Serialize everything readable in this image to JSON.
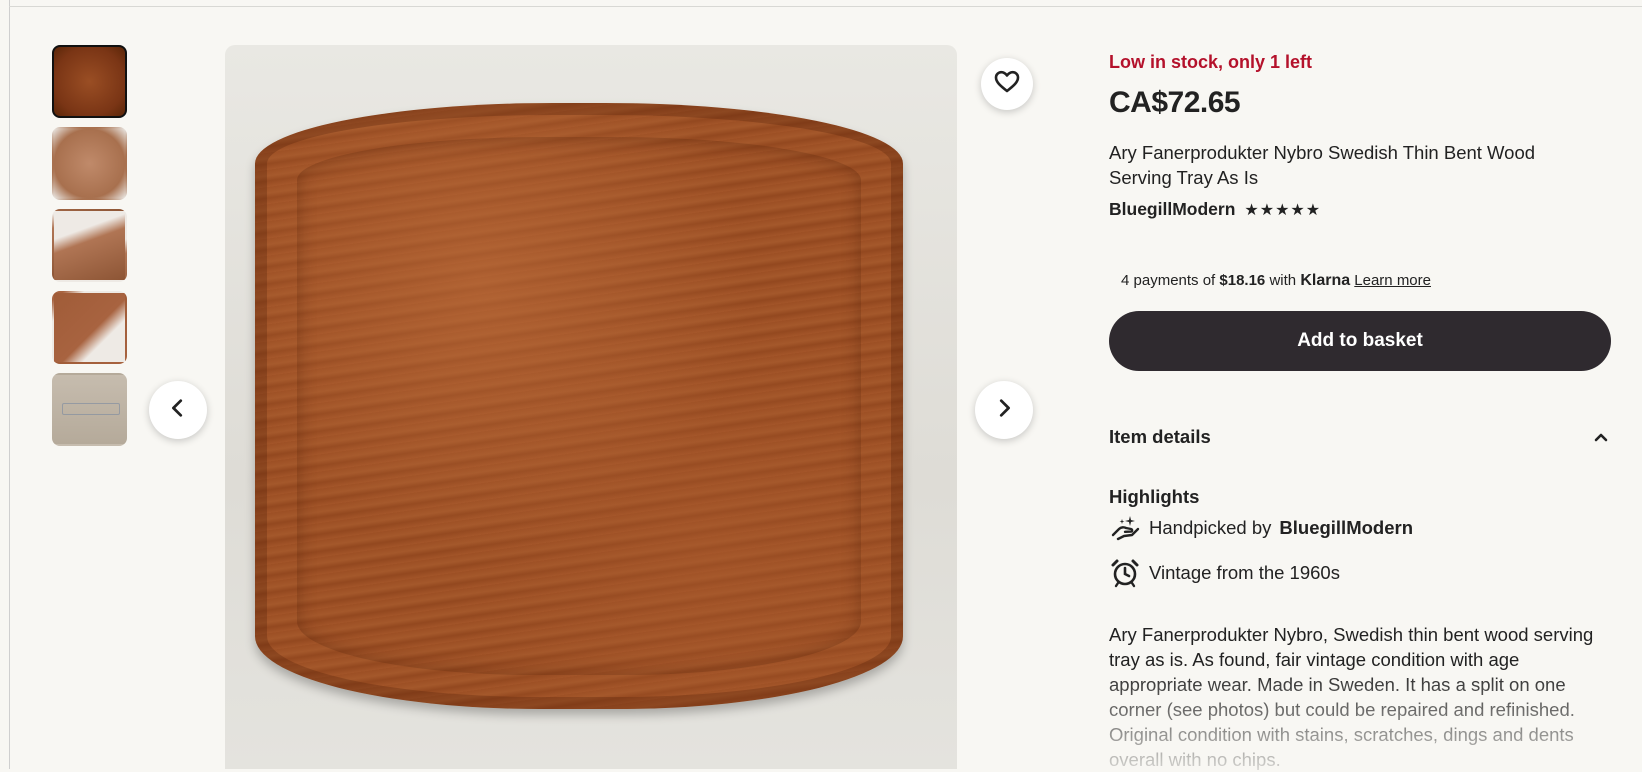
{
  "listing": {
    "stock_notice": "Low in stock, only 1 left",
    "price": "CA$72.65",
    "title": "Ary Fanerprodukter Nybro Swedish Thin Bent Wood Serving Tray As Is",
    "seller": "BluegillModern",
    "rating_stars": "★★★★★",
    "rating": 5
  },
  "payments": {
    "prefix": "4 payments of",
    "amount": "$18.16",
    "with": "with",
    "provider": "Klarna",
    "learn_more": "Learn more"
  },
  "actions": {
    "add_to_basket": "Add to basket"
  },
  "details": {
    "header": "Item details",
    "highlights_label": "Highlights",
    "handpicked_prefix": "Handpicked by",
    "handpicked_by": "BluegillModern",
    "vintage": "Vintage from the 1960s",
    "description": "Ary Fanerprodukter Nybro, Swedish thin bent wood serving tray as is. As found, fair vintage condition with age appropriate wear. Made in Sweden. It has a split on one corner (see photos) but could be repaired and refinished. Original condition with stains, scratches, dings and dents overall with no chips."
  },
  "gallery": {
    "thumbnail_count": 5,
    "active_index": 0
  },
  "colors": {
    "stock_alert": "#b4112b",
    "button_dark": "#2f2a2f",
    "page_bg": "#f8f7f3"
  },
  "icons": {
    "favorite": "heart-icon",
    "prev": "chevron-left-icon",
    "next": "chevron-right-icon",
    "collapse": "chevron-up-icon",
    "handpicked": "hand-sparkle-icon",
    "vintage": "alarm-clock-icon"
  }
}
